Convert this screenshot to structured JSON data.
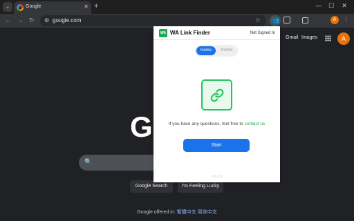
{
  "browser": {
    "tab": {
      "title": "Google",
      "close_glyph": "✕"
    },
    "new_tab_glyph": "+",
    "window_controls": {
      "minimize": "—",
      "maximize": "☐",
      "close": "✕"
    },
    "tab_menu_glyph": "⌄",
    "nav": {
      "back": "←",
      "forward": "→",
      "reload": "↻"
    },
    "omnibox": {
      "url": "google.com",
      "site_info_glyph": "⚙",
      "star_glyph": "☆"
    },
    "extension_glyph": "👥",
    "profile_initial": "A",
    "menu_glyph": "⋮"
  },
  "google_page": {
    "gmail": "Gmail",
    "images": "Images",
    "avatar_initial": "A",
    "logo": "G",
    "search_glyph": "🔍",
    "buttons": {
      "search": "Google Search",
      "lucky": "I'm Feeling Lucky"
    },
    "offered_in": {
      "prefix": "Google offered in:",
      "lang1": "繁體中文",
      "lang2": "简体中文"
    }
  },
  "popup": {
    "title": "WA Link Finder",
    "logo_text": "WA",
    "status": "Not Signed In",
    "tabs": {
      "home": "Home",
      "profile": "Profile"
    },
    "message_prefix": "If you have any questions, feel free to",
    "contact_link": "contact us",
    "start_button": "Start",
    "version": "V1.0.0"
  },
  "colors": {
    "accent_blue": "#1a73e8",
    "accent_green": "#22c55e",
    "page_bg": "#202124"
  }
}
